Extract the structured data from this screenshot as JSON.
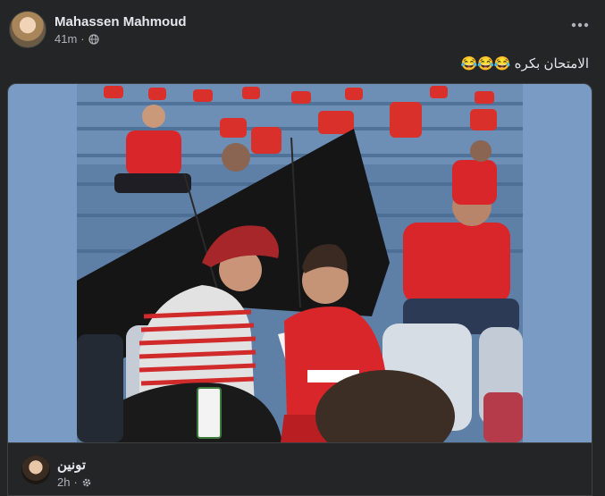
{
  "post": {
    "author": "Mahassen Mahmoud",
    "time": "41m",
    "separator": "·",
    "privacy_icon": "globe-icon",
    "more_icon": "more-horizontal-icon",
    "text": "الامتحان بكره 😂😂😂"
  },
  "shared": {
    "author": "تونين",
    "time": "2h",
    "separator": "·",
    "privacy_icon": "gear-icon"
  },
  "colors": {
    "background": "#242526",
    "photo_frame": "#7a9cc4",
    "text_primary": "#e4e6eb",
    "text_secondary": "#b0b3b8"
  }
}
